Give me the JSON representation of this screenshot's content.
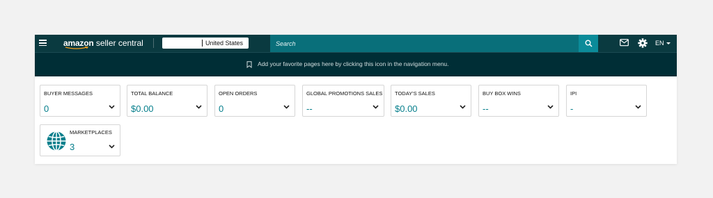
{
  "header": {
    "logo_brand": "amazon",
    "logo_product": " seller central",
    "marketplace": "United States",
    "search_placeholder": "Search",
    "language": "EN"
  },
  "favorites_bar": {
    "text": "Add your favorite pages here by clicking this icon in the navigation menu."
  },
  "widgets": [
    {
      "title": "BUYER MESSAGES",
      "value": "0"
    },
    {
      "title": "TOTAL BALANCE",
      "value": "$0.00"
    },
    {
      "title": "OPEN ORDERS",
      "value": "0"
    },
    {
      "title": "GLOBAL PROMOTIONS SALES",
      "value": "--"
    },
    {
      "title": "TODAY'S SALES",
      "value": "$0.00"
    },
    {
      "title": "BUY BOX WINS",
      "value": "--"
    },
    {
      "title": "IPI",
      "value": "-"
    },
    {
      "title": "MARKETPLACES",
      "value": "3"
    }
  ],
  "colors": {
    "nav_bg": "#0a3a40",
    "search_bg": "#096f7a",
    "search_button": "#0b8b99",
    "favbar_bg": "#002e36",
    "value_accent": "#077f8c"
  },
  "icons": [
    "hamburger-menu-icon",
    "amazon-smile-icon",
    "search-icon",
    "mail-icon",
    "gear-icon",
    "bookmark-icon",
    "globe-icon",
    "chevron-down-icon"
  ]
}
